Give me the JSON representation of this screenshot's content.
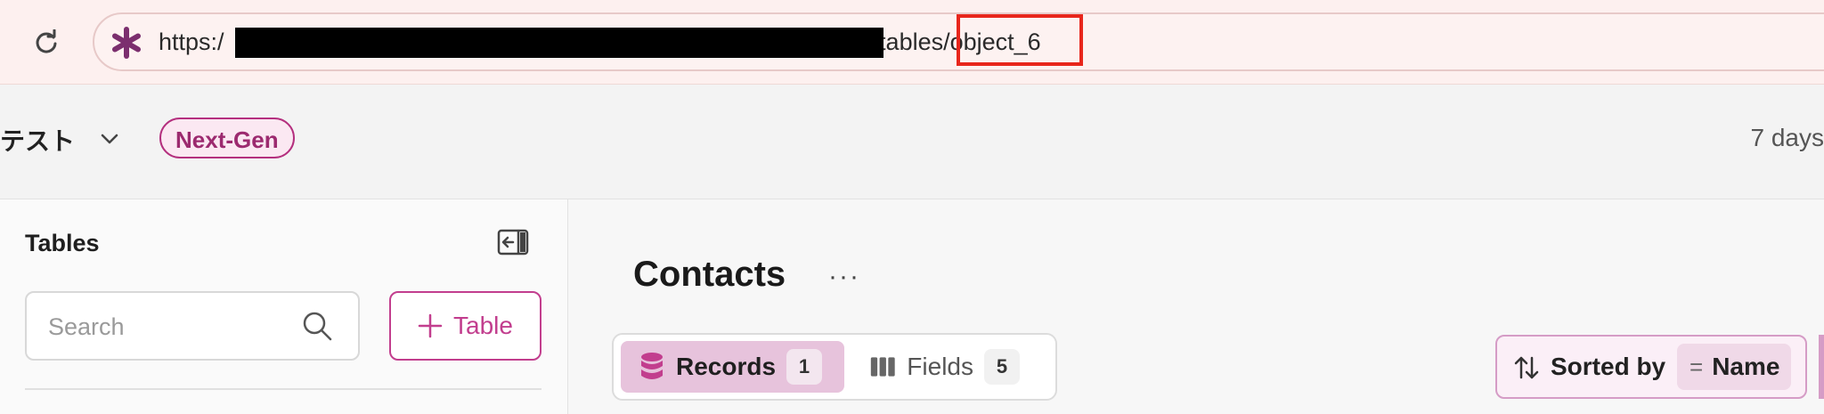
{
  "browser": {
    "url_prefix": "https:/",
    "url_middle": "/tables/",
    "url_slug": "object_6"
  },
  "workspace": {
    "name": "テスト",
    "badge": "Next-Gen",
    "updated": "7 days"
  },
  "sidebar": {
    "title": "Tables",
    "search_placeholder": "Search",
    "add_table_label": "Table"
  },
  "main": {
    "title": "Contacts",
    "more": "···",
    "tabs": [
      {
        "label": "Records",
        "count": "1",
        "active": true
      },
      {
        "label": "Fields",
        "count": "5",
        "active": false
      }
    ],
    "sort": {
      "label": "Sorted by",
      "field": "Name"
    }
  },
  "colors": {
    "accent": "#c23e8e",
    "highlight_box": "#e8261c",
    "records_tab_bg": "#e7c3dc"
  },
  "icons": [
    "reload-icon",
    "site-asterisk-icon",
    "chevron-down-icon",
    "collapse-sidebar-icon",
    "search-icon",
    "plus-icon",
    "database-icon",
    "columns-icon",
    "sort-arrows-icon",
    "equals-icon"
  ]
}
